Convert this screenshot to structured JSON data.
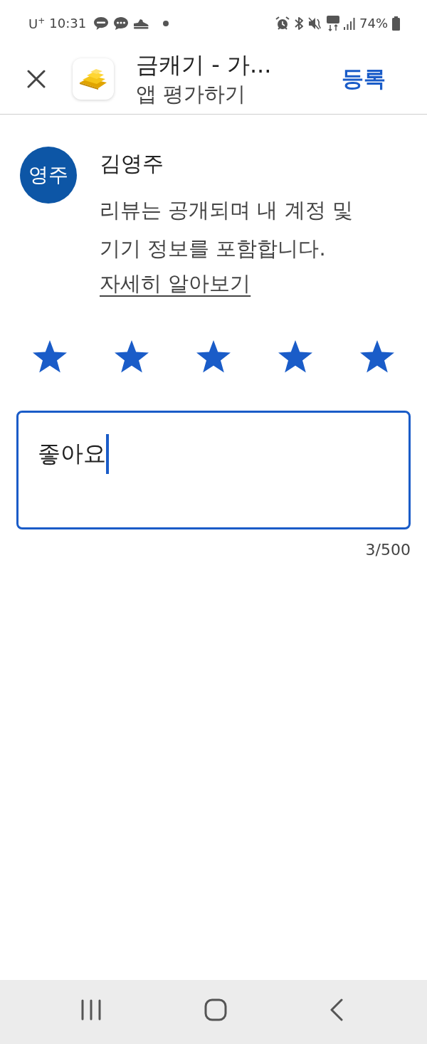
{
  "status_bar": {
    "carrier": "U$^{+}$",
    "time": "10:31",
    "battery": "74%"
  },
  "header": {
    "title": "금캐기 - 가...",
    "subtitle": "앱 평가하기",
    "action": "등록"
  },
  "user": {
    "initials": "영주",
    "color": "#0d56a6",
    "name": "김영주",
    "notice": "리뷰는 공개되며 내 계정 및 기기 정보를 포함합니다.",
    "link": "자세히 알아보기"
  },
  "rating": {
    "stars": 5
  },
  "review": {
    "value": "좋아요",
    "focused": true,
    "counter": "3/500"
  }
}
